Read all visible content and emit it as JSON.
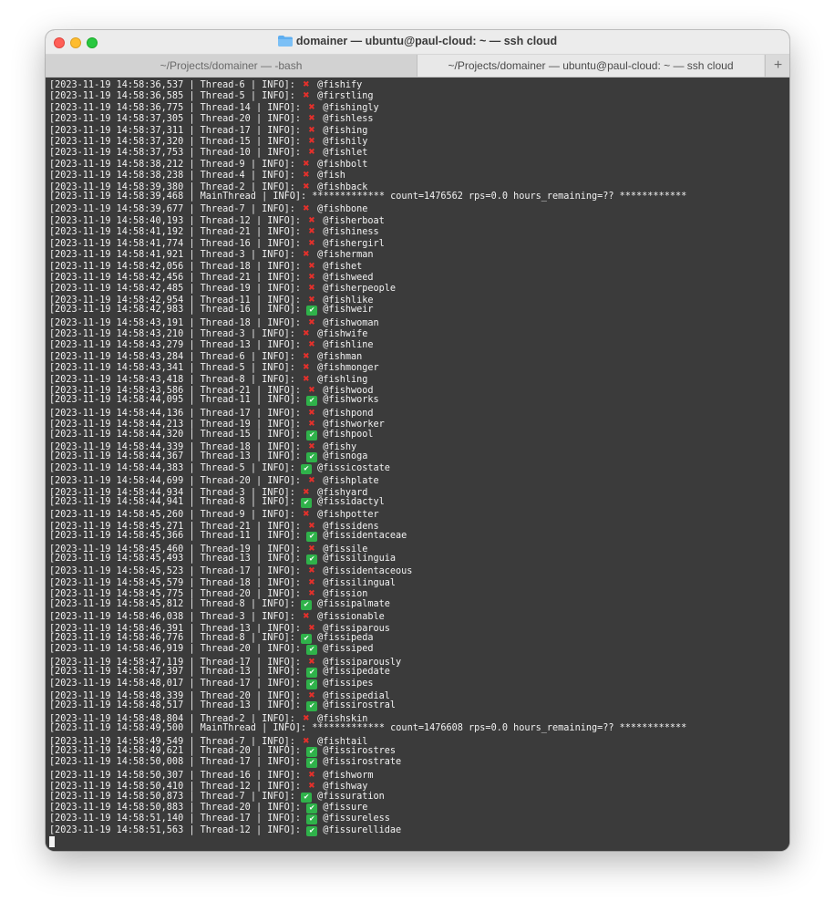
{
  "window": {
    "title": "domainer — ubuntu@paul-cloud: ~ — ssh cloud",
    "title_icon": "folder-icon",
    "tabs": [
      {
        "label": "~/Projects/domainer — -bash",
        "active": false
      },
      {
        "label": "~/Projects/domainer — ubuntu@paul-cloud: ~ — ssh cloud",
        "active": true
      }
    ],
    "new_tab_label": "+"
  },
  "colors": {
    "terminal_bg": "#3b3b3b",
    "text": "#f2f2f2",
    "ok": "#2fb24a",
    "fail": "#e5302b"
  },
  "log": [
    {
      "ts": "[2023-11-19 14:58:36,537",
      "thread": "Thread-6",
      "status": "fail",
      "name": "@fishify"
    },
    {
      "ts": "[2023-11-19 14:58:36,585",
      "thread": "Thread-5",
      "status": "fail",
      "name": "@firstling"
    },
    {
      "ts": "[2023-11-19 14:58:36,775",
      "thread": "Thread-14",
      "status": "fail",
      "name": "@fishingly"
    },
    {
      "ts": "[2023-11-19 14:58:37,305",
      "thread": "Thread-20",
      "status": "fail",
      "name": "@fishless"
    },
    {
      "ts": "[2023-11-19 14:58:37,311",
      "thread": "Thread-17",
      "status": "fail",
      "name": "@fishing"
    },
    {
      "ts": "[2023-11-19 14:58:37,320",
      "thread": "Thread-15",
      "status": "fail",
      "name": "@fishily"
    },
    {
      "ts": "[2023-11-19 14:58:37,753",
      "thread": "Thread-10",
      "status": "fail",
      "name": "@fishlet"
    },
    {
      "ts": "[2023-11-19 14:58:38,212",
      "thread": "Thread-9",
      "status": "fail",
      "name": "@fishbolt"
    },
    {
      "ts": "[2023-11-19 14:58:38,238",
      "thread": "Thread-4",
      "status": "fail",
      "name": "@fish"
    },
    {
      "ts": "[2023-11-19 14:58:39,380",
      "thread": "Thread-2",
      "status": "fail",
      "name": "@fishback"
    },
    {
      "ts": "[2023-11-19 14:58:39,468",
      "thread": "MainThread",
      "status": "summary",
      "name": "************* count=1476562 rps=0.0 hours_remaining=?? ************"
    },
    {
      "ts": "[2023-11-19 14:58:39,677",
      "thread": "Thread-7",
      "status": "fail",
      "name": "@fishbone"
    },
    {
      "ts": "[2023-11-19 14:58:40,193",
      "thread": "Thread-12",
      "status": "fail",
      "name": "@fisherboat"
    },
    {
      "ts": "[2023-11-19 14:58:41,192",
      "thread": "Thread-21",
      "status": "fail",
      "name": "@fishiness"
    },
    {
      "ts": "[2023-11-19 14:58:41,774",
      "thread": "Thread-16",
      "status": "fail",
      "name": "@fishergirl"
    },
    {
      "ts": "[2023-11-19 14:58:41,921",
      "thread": "Thread-3",
      "status": "fail",
      "name": "@fisherman"
    },
    {
      "ts": "[2023-11-19 14:58:42,056",
      "thread": "Thread-18",
      "status": "fail",
      "name": "@fishet"
    },
    {
      "ts": "[2023-11-19 14:58:42,456",
      "thread": "Thread-21",
      "status": "fail",
      "name": "@fishweed"
    },
    {
      "ts": "[2023-11-19 14:58:42,485",
      "thread": "Thread-19",
      "status": "fail",
      "name": "@fisherpeople"
    },
    {
      "ts": "[2023-11-19 14:58:42,954",
      "thread": "Thread-11",
      "status": "fail",
      "name": "@fishlike"
    },
    {
      "ts": "[2023-11-19 14:58:42,983",
      "thread": "Thread-16",
      "status": "ok",
      "name": "@fishweir"
    },
    {
      "ts": "[2023-11-19 14:58:43,191",
      "thread": "Thread-18",
      "status": "fail",
      "name": "@fishwoman"
    },
    {
      "ts": "[2023-11-19 14:58:43,210",
      "thread": "Thread-3",
      "status": "fail",
      "name": "@fishwife"
    },
    {
      "ts": "[2023-11-19 14:58:43,279",
      "thread": "Thread-13",
      "status": "fail",
      "name": "@fishline"
    },
    {
      "ts": "[2023-11-19 14:58:43,284",
      "thread": "Thread-6",
      "status": "fail",
      "name": "@fishman"
    },
    {
      "ts": "[2023-11-19 14:58:43,341",
      "thread": "Thread-5",
      "status": "fail",
      "name": "@fishmonger"
    },
    {
      "ts": "[2023-11-19 14:58:43,418",
      "thread": "Thread-8",
      "status": "fail",
      "name": "@fishling"
    },
    {
      "ts": "[2023-11-19 14:58:43,586",
      "thread": "Thread-21",
      "status": "fail",
      "name": "@fishwood"
    },
    {
      "ts": "[2023-11-19 14:58:44,095",
      "thread": "Thread-11",
      "status": "ok",
      "name": "@fishworks"
    },
    {
      "ts": "[2023-11-19 14:58:44,136",
      "thread": "Thread-17",
      "status": "fail",
      "name": "@fishpond"
    },
    {
      "ts": "[2023-11-19 14:58:44,213",
      "thread": "Thread-19",
      "status": "fail",
      "name": "@fishworker"
    },
    {
      "ts": "[2023-11-19 14:58:44,320",
      "thread": "Thread-15",
      "status": "ok",
      "name": "@fishpool"
    },
    {
      "ts": "[2023-11-19 14:58:44,339",
      "thread": "Thread-18",
      "status": "fail",
      "name": "@fishy"
    },
    {
      "ts": "[2023-11-19 14:58:44,367",
      "thread": "Thread-13",
      "status": "ok",
      "name": "@fisnoga"
    },
    {
      "ts": "[2023-11-19 14:58:44,383",
      "thread": "Thread-5",
      "status": "ok",
      "name": "@fissicostate"
    },
    {
      "ts": "[2023-11-19 14:58:44,699",
      "thread": "Thread-20",
      "status": "fail",
      "name": "@fishplate"
    },
    {
      "ts": "[2023-11-19 14:58:44,934",
      "thread": "Thread-3",
      "status": "fail",
      "name": "@fishyard"
    },
    {
      "ts": "[2023-11-19 14:58:44,941",
      "thread": "Thread-8",
      "status": "ok",
      "name": "@fissidactyl"
    },
    {
      "ts": "[2023-11-19 14:58:45,260",
      "thread": "Thread-9",
      "status": "fail",
      "name": "@fishpotter"
    },
    {
      "ts": "[2023-11-19 14:58:45,271",
      "thread": "Thread-21",
      "status": "fail",
      "name": "@fissidens"
    },
    {
      "ts": "[2023-11-19 14:58:45,366",
      "thread": "Thread-11",
      "status": "ok",
      "name": "@fissidentaceae"
    },
    {
      "ts": "[2023-11-19 14:58:45,460",
      "thread": "Thread-19",
      "status": "fail",
      "name": "@fissile"
    },
    {
      "ts": "[2023-11-19 14:58:45,493",
      "thread": "Thread-13",
      "status": "ok",
      "name": "@fissilinguia"
    },
    {
      "ts": "[2023-11-19 14:58:45,523",
      "thread": "Thread-17",
      "status": "fail",
      "name": "@fissidentaceous"
    },
    {
      "ts": "[2023-11-19 14:58:45,579",
      "thread": "Thread-18",
      "status": "fail",
      "name": "@fissilingual"
    },
    {
      "ts": "[2023-11-19 14:58:45,775",
      "thread": "Thread-20",
      "status": "fail",
      "name": "@fission"
    },
    {
      "ts": "[2023-11-19 14:58:45,812",
      "thread": "Thread-8",
      "status": "ok",
      "name": "@fissipalmate"
    },
    {
      "ts": "[2023-11-19 14:58:46,038",
      "thread": "Thread-3",
      "status": "fail",
      "name": "@fissionable"
    },
    {
      "ts": "[2023-11-19 14:58:46,391",
      "thread": "Thread-13",
      "status": "fail",
      "name": "@fissiparous"
    },
    {
      "ts": "[2023-11-19 14:58:46,776",
      "thread": "Thread-8",
      "status": "ok",
      "name": "@fissipeda"
    },
    {
      "ts": "[2023-11-19 14:58:46,919",
      "thread": "Thread-20",
      "status": "ok",
      "name": "@fissiped"
    },
    {
      "ts": "[2023-11-19 14:58:47,119",
      "thread": "Thread-17",
      "status": "fail",
      "name": "@fissiparously"
    },
    {
      "ts": "[2023-11-19 14:58:47,397",
      "thread": "Thread-13",
      "status": "ok",
      "name": "@fissipedate"
    },
    {
      "ts": "[2023-11-19 14:58:48,017",
      "thread": "Thread-17",
      "status": "ok",
      "name": "@fissipes"
    },
    {
      "ts": "[2023-11-19 14:58:48,339",
      "thread": "Thread-20",
      "status": "fail",
      "name": "@fissipedial"
    },
    {
      "ts": "[2023-11-19 14:58:48,517",
      "thread": "Thread-13",
      "status": "ok",
      "name": "@fissirostral"
    },
    {
      "ts": "[2023-11-19 14:58:48,804",
      "thread": "Thread-2",
      "status": "fail",
      "name": "@fishskin"
    },
    {
      "ts": "[2023-11-19 14:58:49,500",
      "thread": "MainThread",
      "status": "summary",
      "name": "************* count=1476608 rps=0.0 hours_remaining=?? ************"
    },
    {
      "ts": "[2023-11-19 14:58:49,549",
      "thread": "Thread-7",
      "status": "fail",
      "name": "@fishtail"
    },
    {
      "ts": "[2023-11-19 14:58:49,621",
      "thread": "Thread-20",
      "status": "ok",
      "name": "@fissirostres"
    },
    {
      "ts": "[2023-11-19 14:58:50,008",
      "thread": "Thread-17",
      "status": "ok",
      "name": "@fissirostrate"
    },
    {
      "ts": "[2023-11-19 14:58:50,307",
      "thread": "Thread-16",
      "status": "fail",
      "name": "@fishworm"
    },
    {
      "ts": "[2023-11-19 14:58:50,410",
      "thread": "Thread-12",
      "status": "fail",
      "name": "@fishway"
    },
    {
      "ts": "[2023-11-19 14:58:50,873",
      "thread": "Thread-7",
      "status": "ok",
      "name": "@fissuration"
    },
    {
      "ts": "[2023-11-19 14:58:50,883",
      "thread": "Thread-20",
      "status": "ok",
      "name": "@fissure"
    },
    {
      "ts": "[2023-11-19 14:58:51,140",
      "thread": "Thread-17",
      "status": "ok",
      "name": "@fissureless"
    },
    {
      "ts": "[2023-11-19 14:58:51,563",
      "thread": "Thread-12",
      "status": "ok",
      "name": "@fissurellidae"
    }
  ],
  "icons": {
    "ok": "check-mark-icon",
    "fail": "cross-mark-icon",
    "cursor": "block-cursor"
  }
}
